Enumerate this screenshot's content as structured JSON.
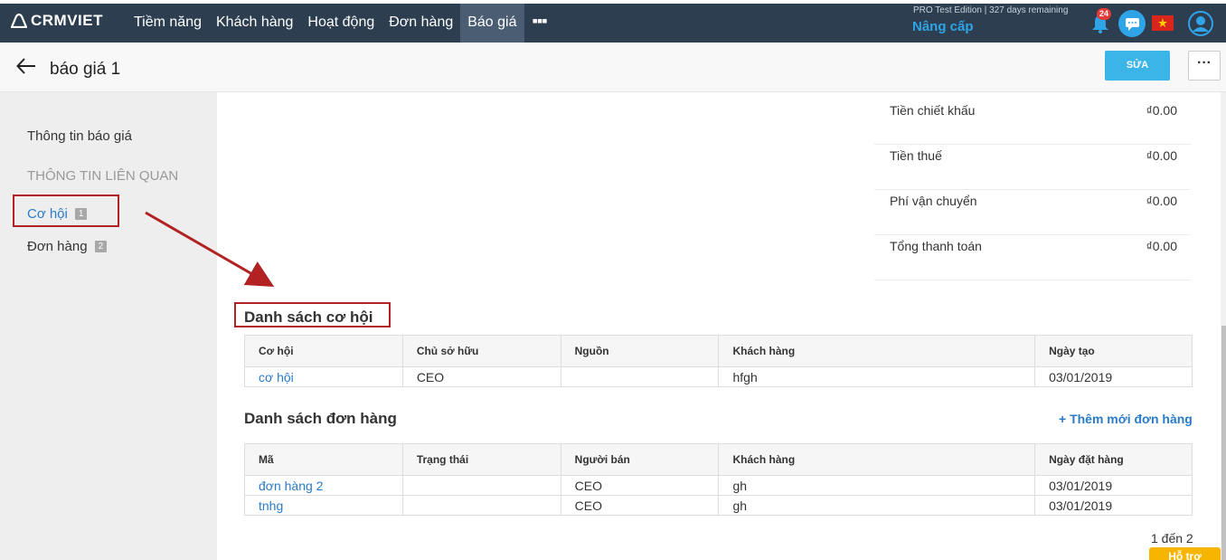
{
  "app": {
    "logo_text": "CRMVIET"
  },
  "nav": {
    "items": [
      {
        "label": "Tiềm năng"
      },
      {
        "label": "Khách hàng"
      },
      {
        "label": "Hoạt động"
      },
      {
        "label": "Đơn hàng"
      },
      {
        "label": "Báo giá",
        "active": true
      }
    ],
    "more_label": "▪▪▪",
    "edition_text": "PRO Test Edition | 327 days remaining",
    "upgrade_label": "Nâng cấp",
    "notification_count": "24"
  },
  "header": {
    "title": "báo giá 1",
    "edit_label": "SỬA",
    "more_label": "···"
  },
  "sidebar": {
    "info_label": "Thông tin báo giá",
    "related_heading": "THÔNG TIN LIÊN QUAN",
    "items": [
      {
        "label": "Cơ hội",
        "count": "1"
      },
      {
        "label": "Đơn hàng",
        "count": "2"
      }
    ]
  },
  "summary": [
    {
      "label": "Tiền chiết khấu",
      "value": "₫0.00"
    },
    {
      "label": "Tiền thuế",
      "value": "₫0.00"
    },
    {
      "label": "Phí vận chuyển",
      "value": "₫0.00"
    },
    {
      "label": "Tổng thanh toán",
      "value": "₫0.00"
    }
  ],
  "opportunities": {
    "title": "Danh sách cơ hội",
    "columns": [
      "Cơ hội",
      "Chủ sở hữu",
      "Nguồn",
      "Khách hàng",
      "Ngày tạo"
    ],
    "rows": [
      [
        "cơ hội",
        "CEO",
        "",
        "hfgh",
        "03/01/2019"
      ]
    ]
  },
  "orders": {
    "title": "Danh sách đơn hàng",
    "add_label": "+ Thêm mới đơn hàng",
    "columns": [
      "Mã",
      "Trạng thái",
      "Người bán",
      "Khách hàng",
      "Ngày đặt hàng"
    ],
    "rows": [
      [
        "đơn hàng 2",
        "",
        "CEO",
        "gh",
        "03/01/2019"
      ],
      [
        "tnhg",
        "",
        "CEO",
        "gh",
        "03/01/2019"
      ]
    ],
    "pager": "1 đến 2"
  },
  "support_label": "Hỗ trợ",
  "colors": {
    "nav_bg": "#2c3e50",
    "accent": "#3bb4e8",
    "link": "#2a7bc8",
    "highlight": "#b22222"
  }
}
